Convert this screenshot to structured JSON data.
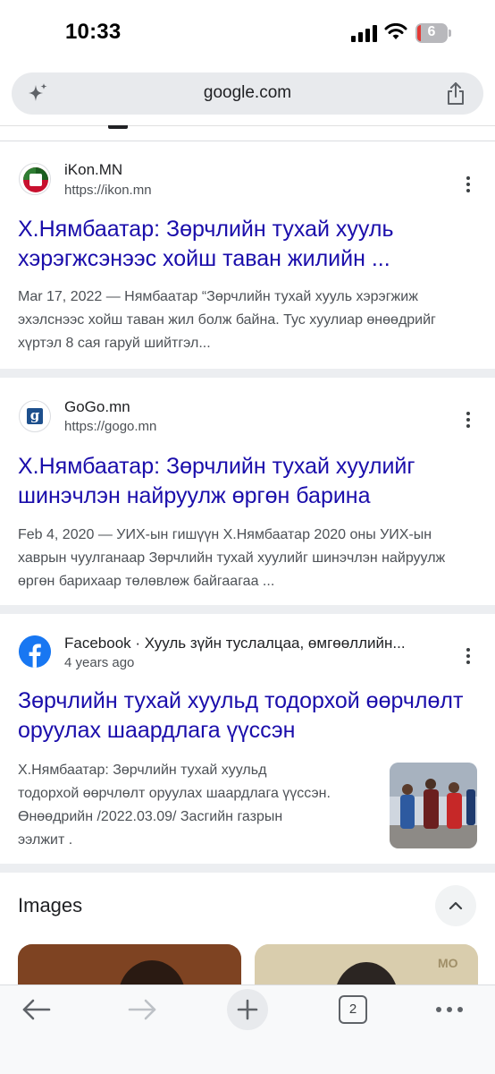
{
  "status": {
    "time": "10:33",
    "battery": "6"
  },
  "browser": {
    "url": "google.com",
    "tab_count": "2"
  },
  "results": [
    {
      "source": "iKon.MN",
      "url": "https://ikon.mn",
      "title": "Х.Нямбаатар: Зөрчлийн тухай хууль хэрэгжсэнээс хойш таван жилийн ...",
      "snippet": "Mar 17, 2022 — Нямбаатар “Зөрчлийн тухай хууль хэрэгжиж эхэлснээс хойш таван жил болж байна. Тус хуулиар өнөөдрийг хүртэл 8 сая гаруй шийтгэл..."
    },
    {
      "source": "GoGo.mn",
      "url": "https://gogo.mn",
      "title": "Х.Нямбаатар: Зөрчлийн тухай хуулийг шинэчлэн найруулж өргөн барина",
      "snippet": "Feb 4, 2020 — УИХ-ын гишүүн Х.Нямбаатар 2020 оны УИХ-ын хаврын чуулганаар Зөрчлийн тухай хуулийг шинэчлэн найруулж өргөн барихаар төлөвлөж байгаагаа ..."
    },
    {
      "source": "Facebook · Хууль зүйн туслалцаа, өмгөөллийн...",
      "url": "4 years ago",
      "title": "Зөрчлийн тухай хуульд тодорхой өөрчлөлт оруулах шаардлага үүссэн",
      "snippet": "Х.Нямбаатар: Зөрчлийн тухай хуульд тодорхой өөрчлөлт оруулах шаардлага үүссэн. Өнөөдрийн /2022.03.09/ Засгийн газрын ээлжит ."
    }
  ],
  "images_section": {
    "title": "Images"
  },
  "icons": {
    "sparkle": "sparkle-icon",
    "share": "share-icon",
    "more": "more-vert-icon",
    "back": "back-arrow-icon",
    "forward": "forward-arrow-icon",
    "new_tab": "plus-icon",
    "tabs": "tab-switcher-icon",
    "menu": "more-horiz-icon",
    "collapse": "chevron-up-icon"
  },
  "colors": {
    "link": "#1a0dab",
    "facebook": "#1877f2",
    "battery_low": "#e53935"
  }
}
